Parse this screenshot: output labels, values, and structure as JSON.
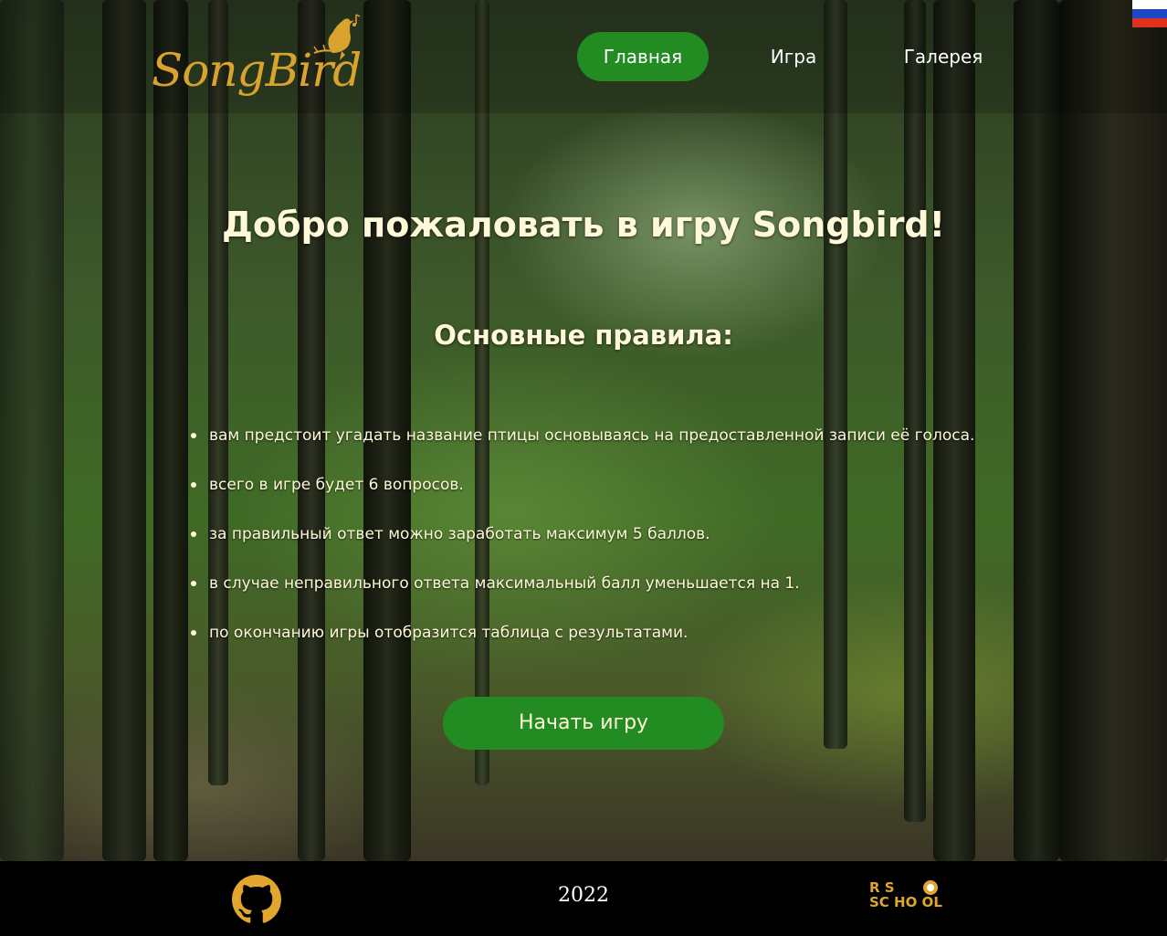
{
  "brand": {
    "name": "SongBird"
  },
  "colors": {
    "accent": "#228b22",
    "logo": "#d9a32e",
    "text": "#fff9d9",
    "footer_bg": "#000000"
  },
  "nav": {
    "items": [
      {
        "label": "Главная",
        "active": true
      },
      {
        "label": "Игра",
        "active": false
      },
      {
        "label": "Галерея",
        "active": false
      }
    ]
  },
  "language_flag": {
    "icon": "russian-flag-icon"
  },
  "main": {
    "title": "Добро пожаловать в игру Songbird!",
    "rules_heading": "Основные правила:",
    "rules": [
      "вам предстоит угадать название птицы основываясь на предоставленной записи её голоса.",
      "всего в игре будет 6 вопросов.",
      "за правильный ответ можно заработать максимум 5 баллов.",
      "в случае неправильного ответа максимальный балл уменьшается на 1.",
      "по окончанию игры отобразится таблица с результатами."
    ],
    "start_button": "Начать игру"
  },
  "footer": {
    "github_icon": "github-icon",
    "year": "2022",
    "rs_school": {
      "line1": "R  S",
      "line2": "SC HO OL"
    }
  }
}
